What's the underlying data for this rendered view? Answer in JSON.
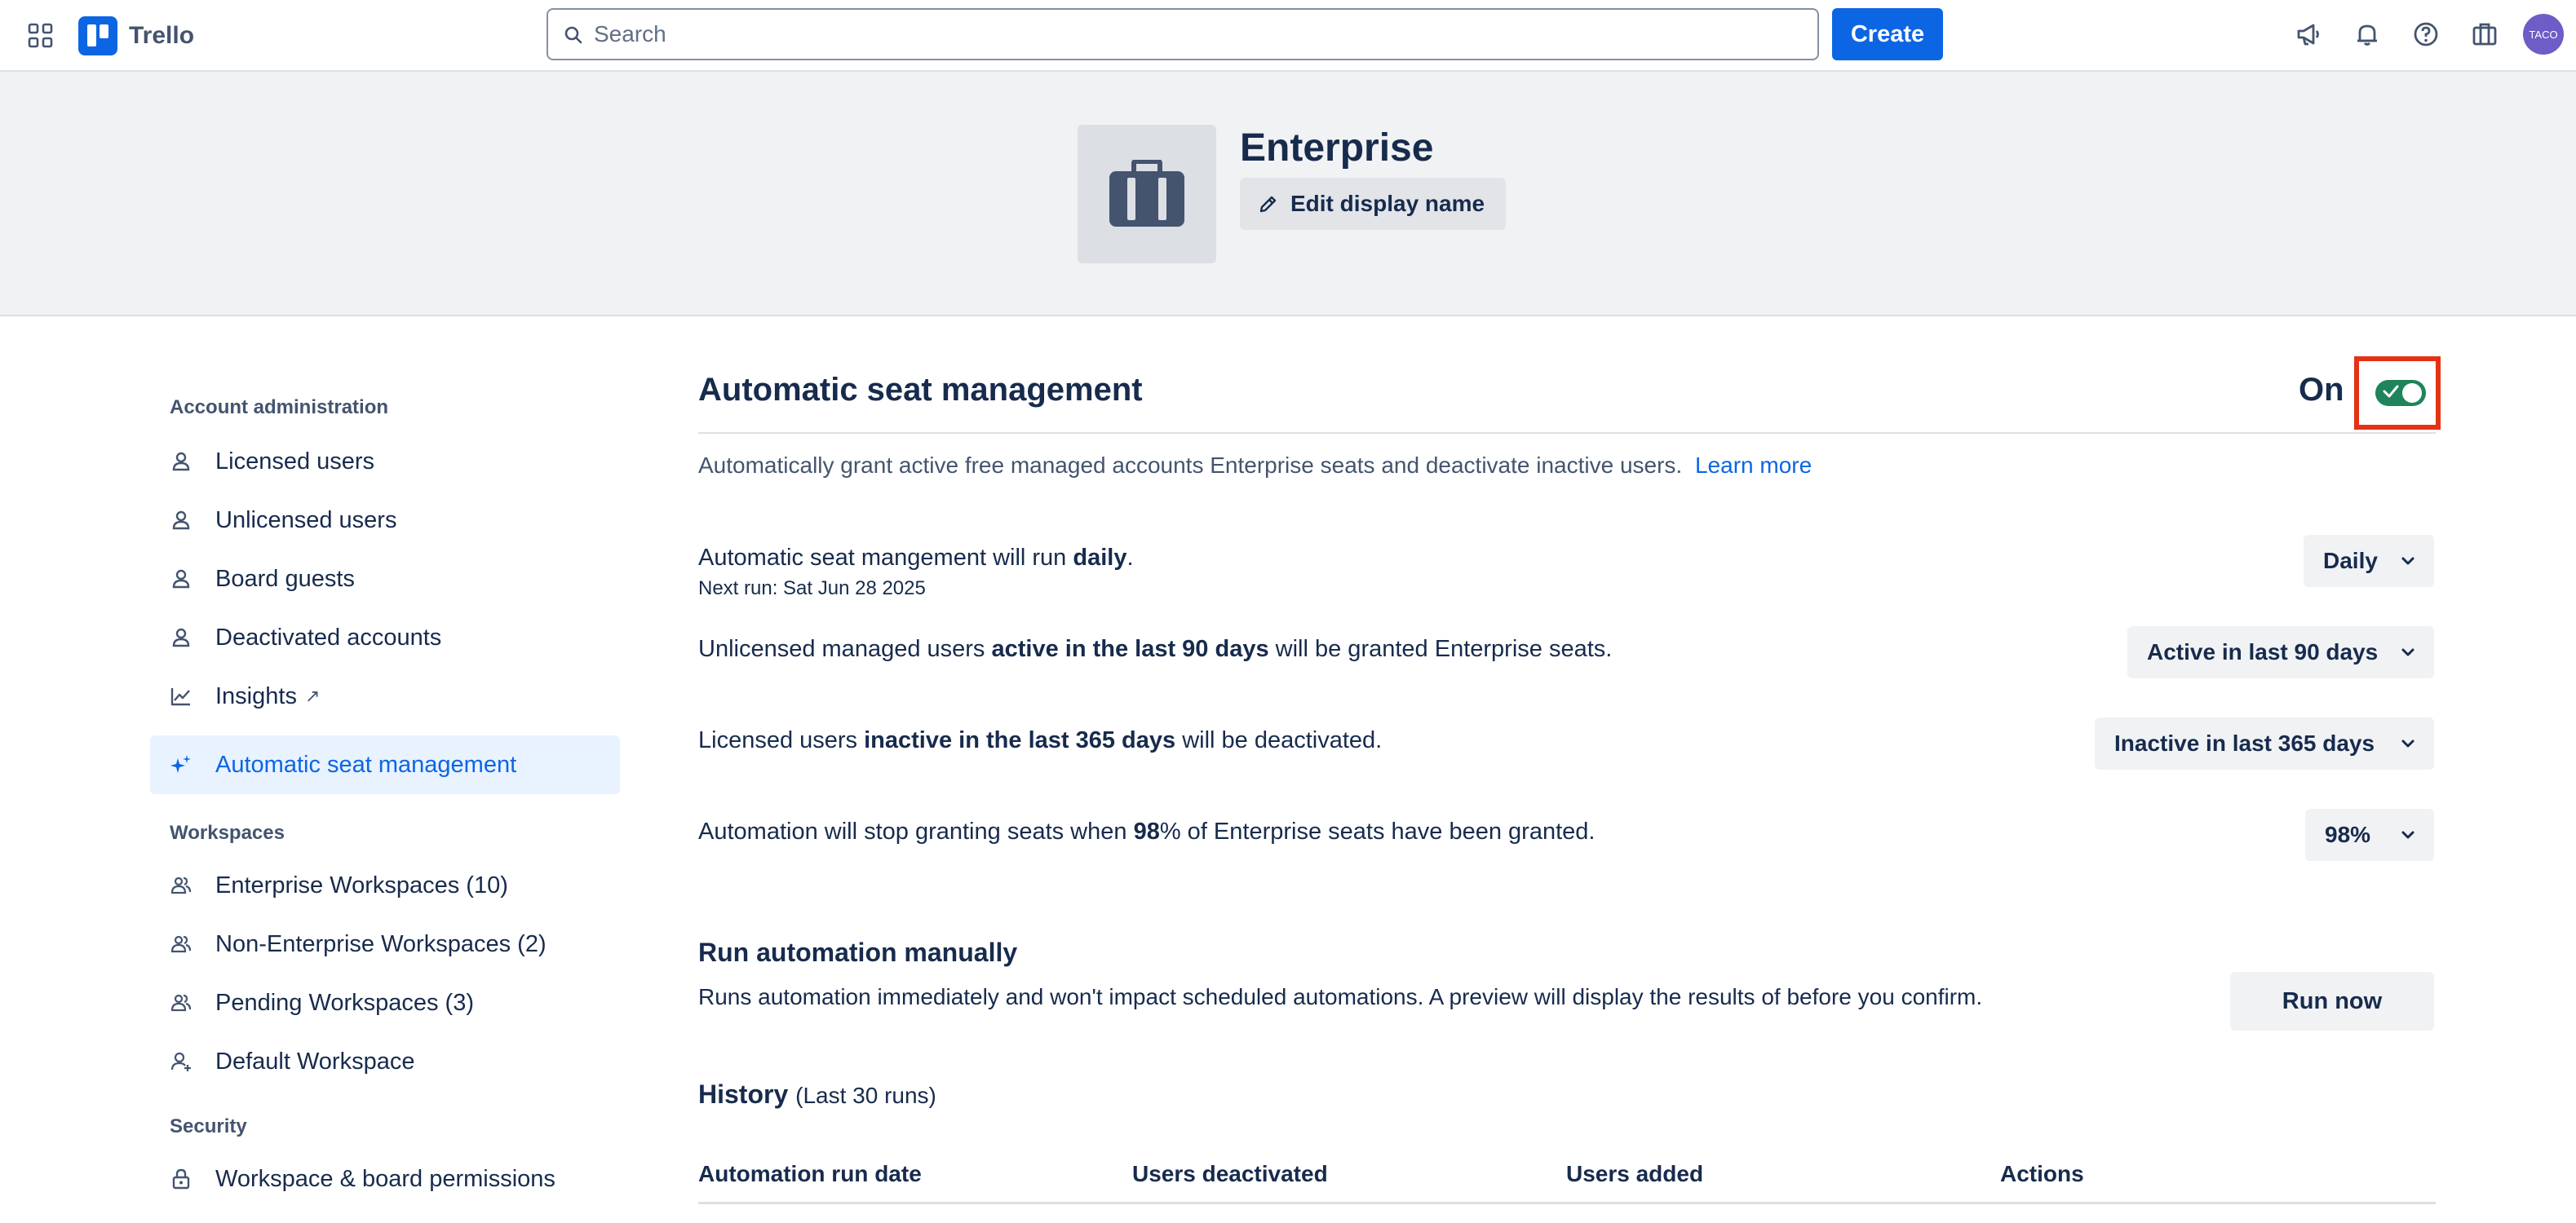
{
  "topbar": {
    "app_name": "Trello",
    "search_placeholder": "Search",
    "create_label": "Create",
    "avatar_initials": "TACO",
    "icons": [
      "apps-grid-icon",
      "megaphone-icon",
      "bell-icon",
      "help-icon",
      "briefcase-icon"
    ]
  },
  "enterprise": {
    "name": "Enterprise",
    "edit_label": "Edit display name"
  },
  "sidebar": {
    "account_heading": "Account administration",
    "account_items": [
      {
        "label": "Licensed users",
        "icon": "person-icon"
      },
      {
        "label": "Unlicensed users",
        "icon": "person-icon"
      },
      {
        "label": "Board guests",
        "icon": "person-icon"
      },
      {
        "label": "Deactivated accounts",
        "icon": "person-icon"
      },
      {
        "label": "Insights",
        "icon": "chart-icon",
        "ext": "↗"
      },
      {
        "label": "Automatic seat management",
        "icon": "sparkle-icon",
        "active": true
      }
    ],
    "workspaces_heading": "Workspaces",
    "workspace_items": [
      {
        "label": "Enterprise Workspaces (10)",
        "icon": "people-icon"
      },
      {
        "label": "Non-Enterprise Workspaces (2)",
        "icon": "people-icon"
      },
      {
        "label": "Pending Workspaces (3)",
        "icon": "people-icon"
      },
      {
        "label": "Default Workspace",
        "icon": "person-add-icon"
      }
    ],
    "security_heading": "Security",
    "security_items": [
      {
        "label": "Workspace & board permissions",
        "icon": "lock-icon"
      }
    ]
  },
  "main": {
    "title": "Automatic seat management",
    "toggle_label": "On",
    "toggle_on": true,
    "description": "Automatically grant active free managed accounts Enterprise seats and deactivate inactive users.",
    "learn_more": "Learn more",
    "settings": [
      {
        "pre": "Automatic seat mangement will run ",
        "bold": "daily",
        "post": ".",
        "dropdown": "Daily"
      },
      {
        "pre": "Unlicensed managed users ",
        "bold": "active in the last 90 days",
        "post": " will be granted Enterprise seats.",
        "dropdown": "Active in last 90 days"
      },
      {
        "pre": "Licensed users ",
        "bold": "inactive in the last 365 days",
        "post": " will be deactivated.",
        "dropdown": "Inactive in last 365 days"
      },
      {
        "pre": "Automation will stop granting seats when ",
        "bold": "98",
        "post": "% of Enterprise seats have been granted.",
        "dropdown": "98%"
      }
    ],
    "next_run": "Next run: Sat Jun 28 2025",
    "manual_title": "Run automation manually",
    "manual_desc": "Runs automation immediately and won't impact scheduled automations. A preview will display the results of before you confirm.",
    "run_now": "Run now",
    "history_title": "History",
    "history_sub": "(Last 30 runs)",
    "table_headers": [
      "Automation run date",
      "Users deactivated",
      "Users added",
      "Actions"
    ]
  },
  "colors": {
    "accent": "#0c66e4",
    "toggle_on": "#1f845a",
    "highlight_frame": "#e53215"
  }
}
